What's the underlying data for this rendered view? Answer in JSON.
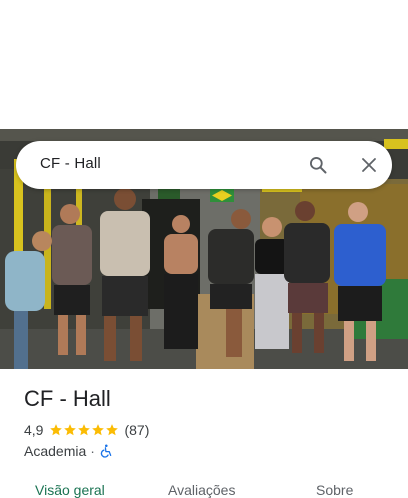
{
  "search": {
    "query": "CF - Hall",
    "search_icon": "search-icon",
    "close_icon": "close-icon"
  },
  "place": {
    "title": "CF - Hall",
    "rating": "4,9",
    "rating_stars": 5,
    "review_count": "(87)",
    "category": "Academia",
    "separator": "·",
    "accessibility_icon": "wheelchair-icon"
  },
  "tabs": [
    {
      "label": "Visão geral",
      "active": true
    },
    {
      "label": "Avaliações",
      "active": false
    },
    {
      "label": "Sobre",
      "active": false
    }
  ],
  "colors": {
    "star": "#fbbc04",
    "active_tab": "#1a7352",
    "accessibility": "#1a73e8"
  }
}
